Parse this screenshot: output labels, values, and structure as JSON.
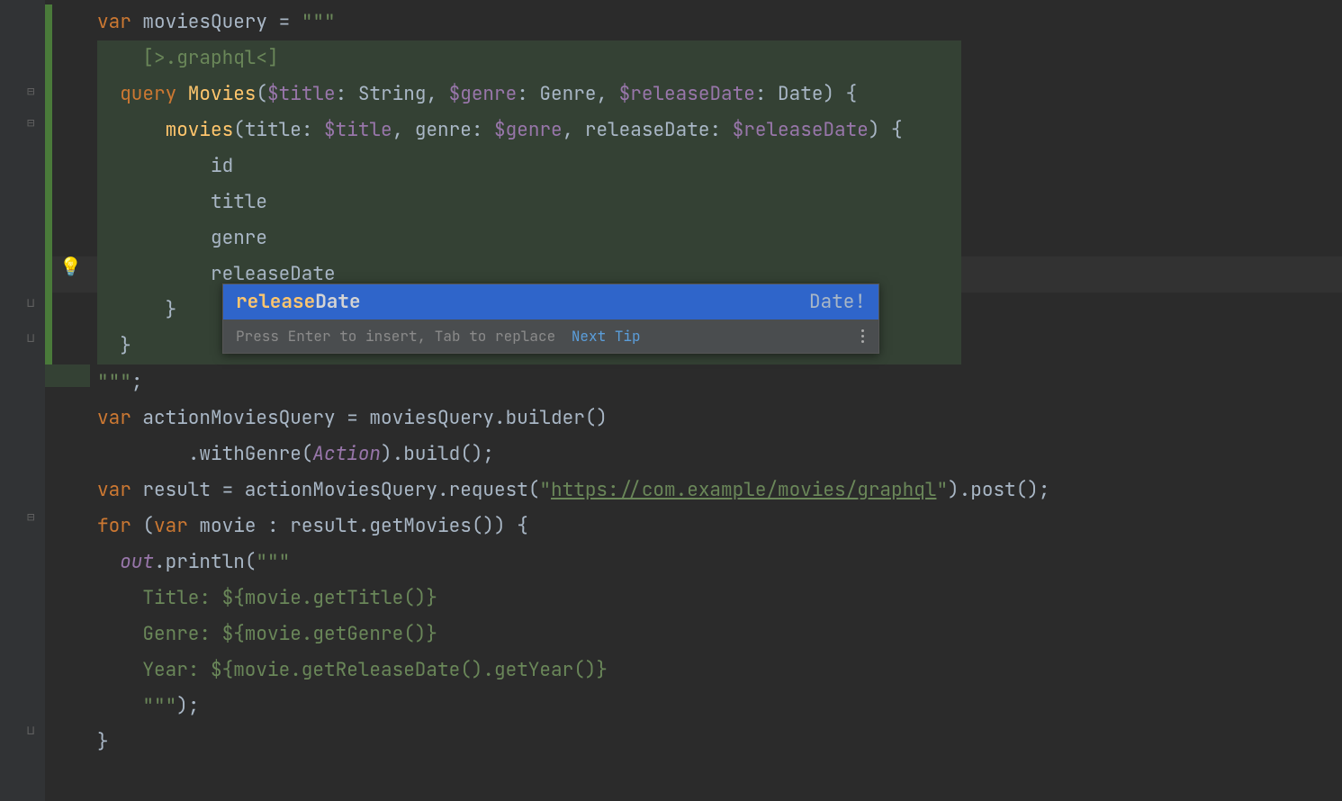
{
  "code": {
    "l1_var": "var",
    "l1_name": " moviesQuery = ",
    "l1_q": "\"\"\"",
    "l2_inj": "[>.graphql<]",
    "l3_query": "query",
    "l3_name": " Movies",
    "l3_open": "(",
    "l3_v1": "$title",
    "l3_c1": ": String, ",
    "l3_v2": "$genre",
    "l3_c2": ": Genre, ",
    "l3_v3": "$releaseDate",
    "l3_c3": ": Date) {",
    "l4_field": "movies",
    "l4_open": "(title: ",
    "l4_v1": "$title",
    "l4_c1": ", genre: ",
    "l4_v2": "$genre",
    "l4_c2": ", releaseDate: ",
    "l4_v3": "$releaseDate",
    "l4_c3": ") {",
    "l5": "id",
    "l6": "title",
    "l7": "genre",
    "l8": "releaseDate",
    "l9": "}",
    "l10": "}",
    "l11_q": "\"\"\"",
    "l11_semi": ";",
    "l12_var": "var",
    "l12_rest": " actionMoviesQuery = moviesQuery.builder()",
    "l13_a": ".withGenre(",
    "l13_b": "Action",
    "l13_c": ").build();",
    "l14_var": "var",
    "l14_a": " result = actionMoviesQuery.request(",
    "l14_q1": "\"",
    "l14_url": "https://com.example/movies/graphql",
    "l14_q2": "\"",
    "l14_b": ").post();",
    "l15_for": "for",
    "l15_a": " (",
    "l15_var": "var",
    "l15_b": " movie : result.getMovies()) {",
    "l16_out": "out",
    "l16_a": ".println(",
    "l16_q": "\"\"\"",
    "l17": "Title: ${movie.getTitle()}",
    "l18": "Genre: ${movie.getGenre()}",
    "l19": "Year: ${movie.getReleaseDate().getYear()}",
    "l20_q": "\"\"\"",
    "l20_a": ");",
    "l21": "}"
  },
  "autocomplete": {
    "match": "release",
    "rest": "Date",
    "type": "Date!",
    "footer_hint": "Press Enter to insert, Tab to replace",
    "next_tip": "Next Tip"
  }
}
